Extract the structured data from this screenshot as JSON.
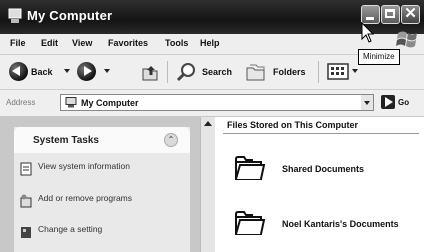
{
  "window": {
    "title": "My Computer",
    "controls": {
      "minimize": "minimize",
      "maximize": "maximize",
      "close": "✕"
    },
    "tooltip": "Minimize"
  },
  "menu": {
    "file": "File",
    "edit": "Edit",
    "view": "View",
    "favorites": "Favorites",
    "tools": "Tools",
    "help": "Help"
  },
  "toolbar": {
    "back": "Back",
    "search": "Search",
    "folders": "Folders"
  },
  "address": {
    "label": "Address",
    "value": "My Computer",
    "go": "Go"
  },
  "tasks": {
    "title": "System Tasks",
    "items": [
      {
        "label": "View system information"
      },
      {
        "label": "Add or remove programs"
      },
      {
        "label": "Change a setting"
      }
    ]
  },
  "files": {
    "group_title": "Files Stored on This Computer",
    "items": [
      {
        "label": "Shared Documents"
      },
      {
        "label": "Noel Kantaris's Documents"
      }
    ]
  }
}
